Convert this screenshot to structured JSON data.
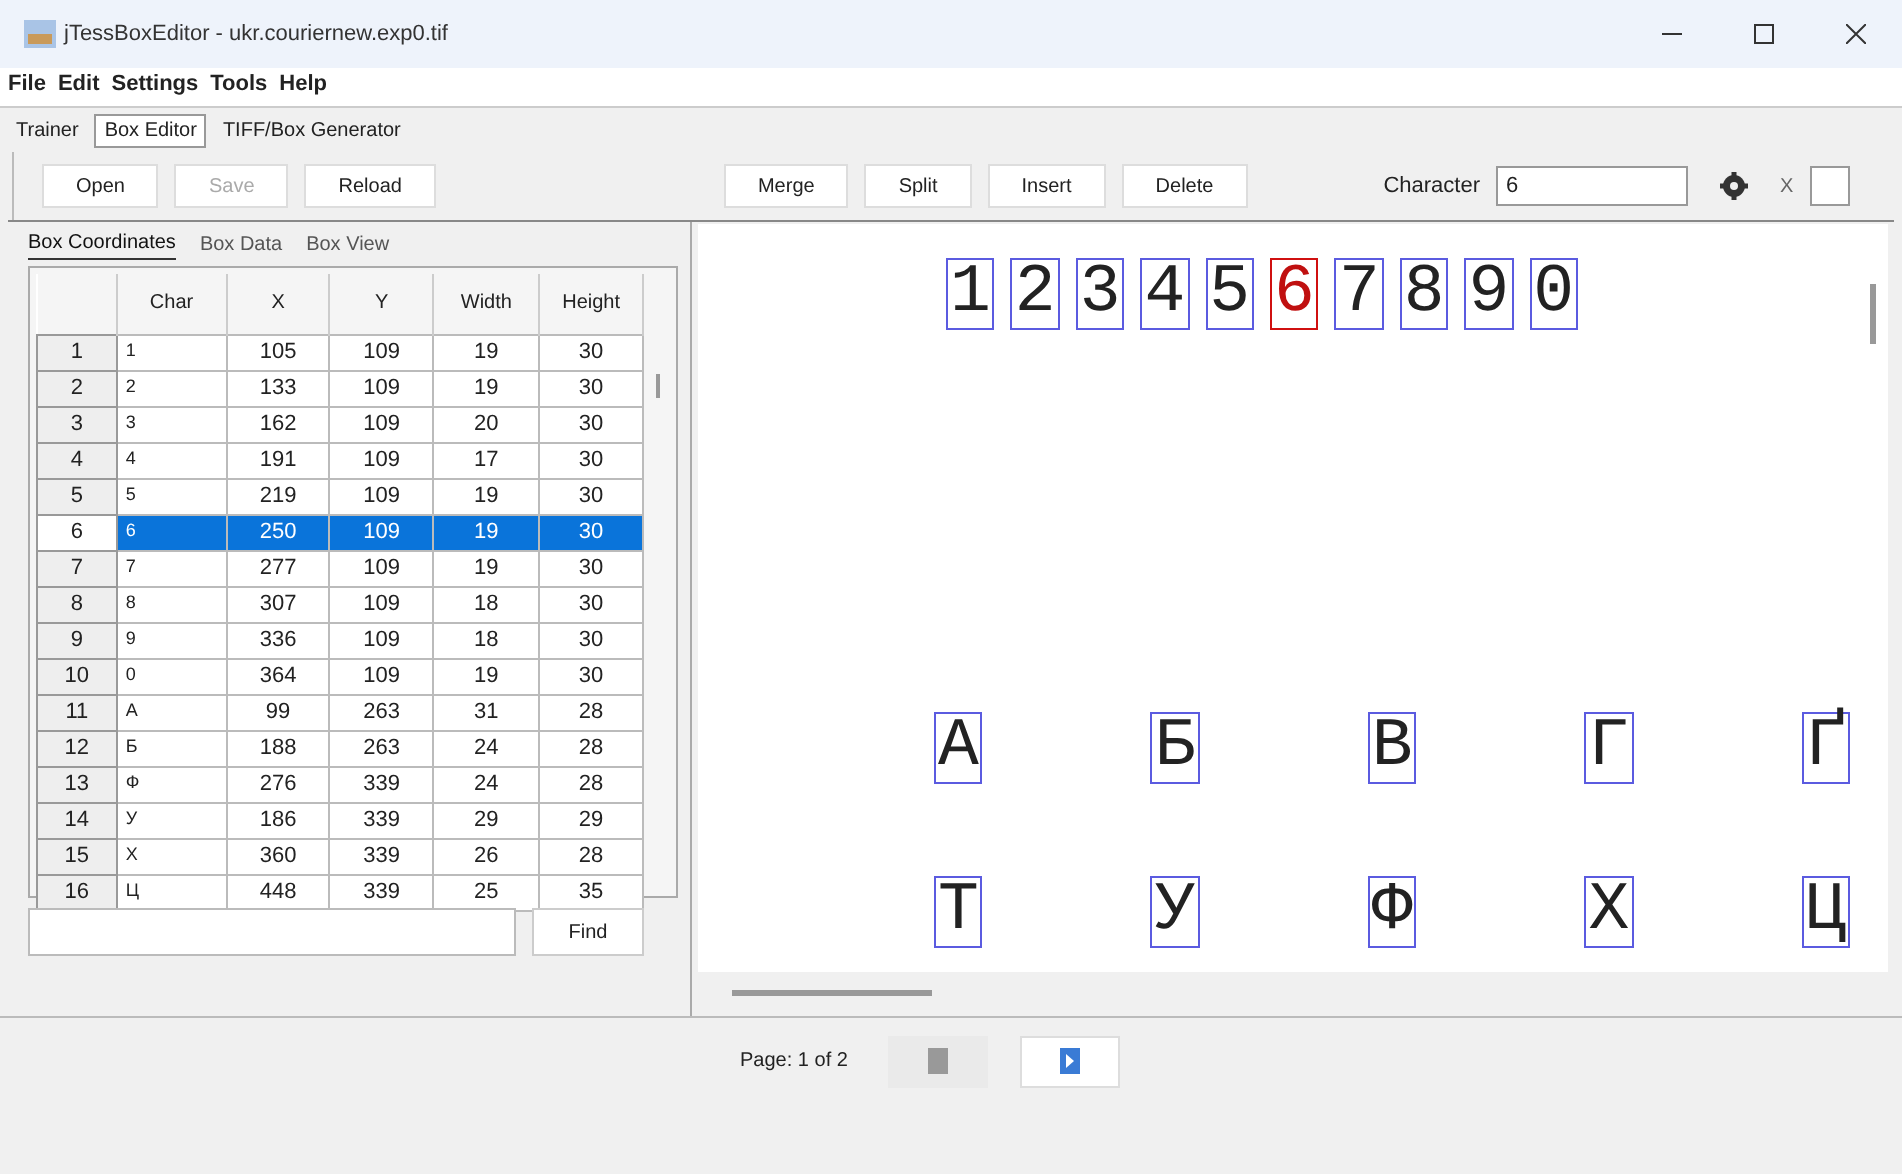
{
  "window": {
    "title": "jTessBoxEditor - ukr.couriernew.exp0.tif"
  },
  "menu": [
    "File",
    "Edit",
    "Settings",
    "Tools",
    "Help"
  ],
  "tabs": [
    {
      "label": "Trainer",
      "selected": false
    },
    {
      "label": "Box Editor",
      "selected": true
    },
    {
      "label": "TIFF/Box Generator",
      "selected": false
    }
  ],
  "toolbar_left": [
    {
      "label": "Open",
      "disabled": false
    },
    {
      "label": "Save",
      "disabled": true
    },
    {
      "label": "Reload",
      "disabled": false
    }
  ],
  "toolbar_right": [
    {
      "label": "Merge",
      "disabled": false
    },
    {
      "label": "Split",
      "disabled": false
    },
    {
      "label": "Insert",
      "disabled": false
    },
    {
      "label": "Delete",
      "disabled": false
    }
  ],
  "character": {
    "label": "Character",
    "value": "6"
  },
  "x_field": {
    "label": "X"
  },
  "box_tabs": [
    {
      "label": "Box Coordinates",
      "selected": true
    },
    {
      "label": "Box Data",
      "selected": false
    },
    {
      "label": "Box View",
      "selected": false
    }
  ],
  "table": {
    "columns": [
      "Char",
      "X",
      "Y",
      "Width",
      "Height"
    ],
    "rows": [
      {
        "index": "1",
        "cells": [
          "1",
          "105",
          "109",
          "19",
          "30"
        ],
        "selected": false
      },
      {
        "index": "2",
        "cells": [
          "2",
          "133",
          "109",
          "19",
          "30"
        ],
        "selected": false
      },
      {
        "index": "3",
        "cells": [
          "3",
          "162",
          "109",
          "20",
          "30"
        ],
        "selected": false
      },
      {
        "index": "4",
        "cells": [
          "4",
          "191",
          "109",
          "17",
          "30"
        ],
        "selected": false
      },
      {
        "index": "5",
        "cells": [
          "5",
          "219",
          "109",
          "19",
          "30"
        ],
        "selected": false
      },
      {
        "index": "6",
        "cells": [
          "6",
          "250",
          "109",
          "19",
          "30"
        ],
        "selected": true
      },
      {
        "index": "7",
        "cells": [
          "7",
          "277",
          "109",
          "19",
          "30"
        ],
        "selected": false
      },
      {
        "index": "8",
        "cells": [
          "8",
          "307",
          "109",
          "18",
          "30"
        ],
        "selected": false
      },
      {
        "index": "9",
        "cells": [
          "9",
          "336",
          "109",
          "18",
          "30"
        ],
        "selected": false
      },
      {
        "index": "10",
        "cells": [
          "0",
          "364",
          "109",
          "19",
          "30"
        ],
        "selected": false
      },
      {
        "index": "11",
        "cells": [
          "А",
          "99",
          "263",
          "31",
          "28"
        ],
        "selected": false
      },
      {
        "index": "12",
        "cells": [
          "Б",
          "188",
          "263",
          "24",
          "28"
        ],
        "selected": false
      },
      {
        "index": "13",
        "cells": [
          "Ф",
          "276",
          "339",
          "24",
          "28"
        ],
        "selected": false
      },
      {
        "index": "14",
        "cells": [
          "У",
          "186",
          "339",
          "29",
          "29"
        ],
        "selected": false
      },
      {
        "index": "15",
        "cells": [
          "Х",
          "360",
          "339",
          "26",
          "28"
        ],
        "selected": false
      },
      {
        "index": "16",
        "cells": [
          "Ц",
          "448",
          "339",
          "25",
          "35"
        ],
        "selected": false
      }
    ]
  },
  "find_button": "Find",
  "canvas": {
    "lines": [
      [
        {
          "char": "1",
          "selected": false
        },
        {
          "char": "2",
          "selected": false
        },
        {
          "char": "3",
          "selected": false
        },
        {
          "char": "4",
          "selected": false
        },
        {
          "char": "5",
          "selected": false
        },
        {
          "char": "6",
          "selected": true
        },
        {
          "char": "7",
          "selected": false
        },
        {
          "char": "8",
          "selected": false
        },
        {
          "char": "9",
          "selected": false
        },
        {
          "char": "0",
          "selected": false
        }
      ],
      [
        {
          "char": "А",
          "selected": false
        },
        {
          "char": "Б",
          "selected": false
        },
        {
          "char": "В",
          "selected": false
        },
        {
          "char": "Г",
          "selected": false
        },
        {
          "char": "Ґ",
          "selected": false
        }
      ],
      [
        {
          "char": "Т",
          "selected": false
        },
        {
          "char": "У",
          "selected": false
        },
        {
          "char": "Ф",
          "selected": false
        },
        {
          "char": "Х",
          "selected": false
        },
        {
          "char": "Ц",
          "selected": false
        }
      ]
    ]
  },
  "page_label": "Page: 1 of 2",
  "page_buttons": [
    {
      "kind": "previous",
      "disabled": true
    },
    {
      "kind": "next",
      "disabled": false
    }
  ]
}
